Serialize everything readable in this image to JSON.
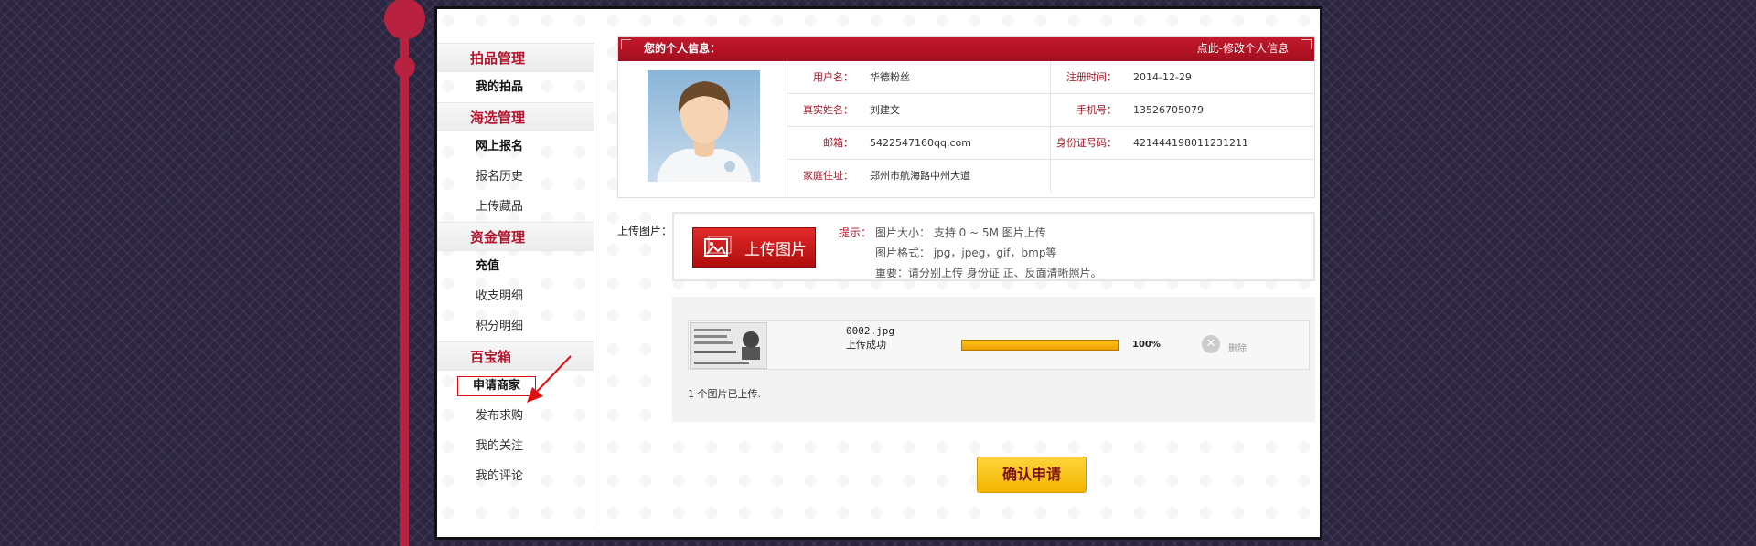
{
  "sidebar": {
    "sections": [
      {
        "title": "拍品管理",
        "items": [
          {
            "label": "我的拍品",
            "bold": true
          }
        ]
      },
      {
        "title": "海选管理",
        "items": [
          {
            "label": "网上报名",
            "bold": true
          },
          {
            "label": "报名历史"
          },
          {
            "label": "上传藏品"
          }
        ]
      },
      {
        "title": "资金管理",
        "items": [
          {
            "label": "充值",
            "bold": true
          },
          {
            "label": "收支明细"
          },
          {
            "label": "积分明细"
          }
        ]
      },
      {
        "title": "百宝箱",
        "items": [
          {
            "label": "申请商家",
            "bold": true,
            "boxed": true
          },
          {
            "label": "发布求购"
          },
          {
            "label": "我的关注"
          },
          {
            "label": "我的评论"
          }
        ]
      }
    ]
  },
  "profile": {
    "title": "您的个人信息：",
    "edit_link": "点此-修改个人信息",
    "fields": [
      {
        "k1": "用户名：",
        "v1": "华德粉丝",
        "k2": "注册时间：",
        "v2": "2014-12-29"
      },
      {
        "k1": "真实姓名：",
        "v1": "刘建文",
        "k2": "手机号：",
        "v2": "13526705079"
      },
      {
        "k1": "邮箱：",
        "v1": "5422547160qq.com",
        "k2": "身份证号码：",
        "v2": "421444198011231211"
      },
      {
        "k1": "家庭住址：",
        "v1": "郑州市航海路中州大道",
        "k2": "",
        "v2": ""
      }
    ]
  },
  "upload": {
    "label": "上传图片：",
    "button": "上传图片",
    "tip_label": "提示：",
    "tips": [
      "图片大小： 支持 0 ~ 5M 图片上传",
      "图片格式： jpg，jpeg，gif，bmp等",
      "重要：请分别上传 身份证 正、反面清晰照片。"
    ]
  },
  "queue": {
    "file_name": "0002.jpg",
    "status": "上传成功",
    "progress": 1.0,
    "progress_text": "100%",
    "delete_label": "删除",
    "summary": "1 个图片已上传."
  },
  "confirm_button": "确认申请"
}
